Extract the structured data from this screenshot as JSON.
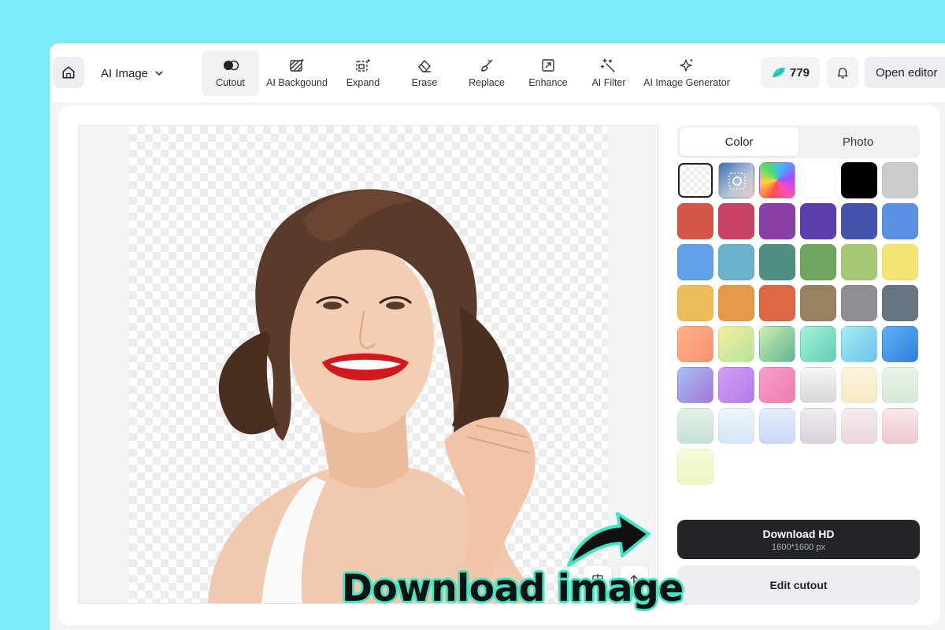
{
  "toolbar": {
    "home_icon": "home-icon",
    "mode_label": "AI Image",
    "tools": [
      {
        "label": "Cutout",
        "icon": "cutout-icon",
        "active": true
      },
      {
        "label": "AI Backgound",
        "icon": "ai-background-icon",
        "active": false
      },
      {
        "label": "Expand",
        "icon": "expand-icon",
        "active": false
      },
      {
        "label": "Erase",
        "icon": "eraser-icon",
        "active": false
      },
      {
        "label": "Replace",
        "icon": "brush-icon",
        "active": false
      },
      {
        "label": "Enhance",
        "icon": "enhance-icon",
        "active": false
      },
      {
        "label": "AI Filter",
        "icon": "magic-wand-icon",
        "active": false
      },
      {
        "label": "AI Image Generator",
        "icon": "sparkle-icon",
        "active": false
      }
    ],
    "credits": "779",
    "open_editor_label": "Open editor"
  },
  "panel": {
    "tabs": [
      {
        "label": "Color",
        "active": true
      },
      {
        "label": "Photo",
        "active": false
      }
    ],
    "swatches": [
      "transparent",
      "custom",
      "spectrum",
      "#ffffff",
      "#000000",
      "#cbcbcb",
      "#d3574b",
      "#c94464",
      "#8a3fa6",
      "#5e3eab",
      "#4554ab",
      "#5a92e3",
      "#5ea1e6",
      "#6ab1cb",
      "#4f8f84",
      "#6fa55f",
      "#a7c872",
      "#f5e474",
      "#ebbd58",
      "#e49a48",
      "#dd6843",
      "#9a8260",
      "#8e8f92",
      "#677583",
      "linear-gradient(135deg,#fbb48a,#fb8f70)",
      "linear-gradient(135deg,#f4ee9a,#b6e3a0)",
      "linear-gradient(135deg,#d3edb0,#5fb396)",
      "linear-gradient(135deg,#a8f0d3,#5fcfb8)",
      "linear-gradient(135deg,#a5ecf4,#6cc3ea)",
      "linear-gradient(135deg,#5fb1f2,#2f7fe0)",
      "linear-gradient(135deg,#a3c1f1,#a576d9)",
      "linear-gradient(135deg,#d39ef5,#b27be8)",
      "linear-gradient(135deg,#f7a0c8,#ee7bb0)",
      "linear-gradient(180deg,#f6f6f6,#d7d7d7)",
      "linear-gradient(180deg,#fbf4dc,#f6e9c4)",
      "linear-gradient(180deg,#eaf4ea,#d5e9d4)",
      "linear-gradient(180deg,#e5f1eb,#c4e2d3)",
      "linear-gradient(180deg,#eef5fc,#d4e6f7)",
      "linear-gradient(180deg,#e6ecfb,#c9d6f6)",
      "linear-gradient(180deg,#efecf1,#d8d0dc)",
      "linear-gradient(180deg,#f5ecef,#e9d6dc)",
      "linear-gradient(180deg,#f7e8ea,#ecc9cd)",
      "linear-gradient(180deg,#f7fbd9,#edf5c2)"
    ],
    "selected_swatch": 0,
    "download_label": "Download HD",
    "download_size": "1600*1600 px",
    "edit_label": "Edit cutout"
  },
  "canvas": {
    "compare_icon": "compare-icon",
    "upload_icon": "upload-icon"
  },
  "annotation": {
    "text": "Download image",
    "arrow_icon": "curved-arrow-icon",
    "color": "#3ee6c3"
  },
  "colors": {
    "page_bg": "#79ecf7",
    "primary_button": "#222428"
  }
}
